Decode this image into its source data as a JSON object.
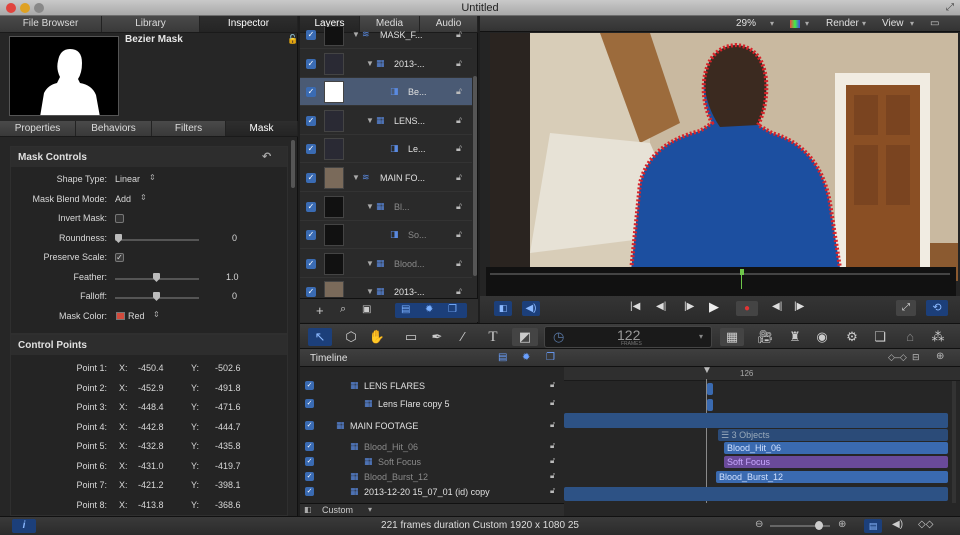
{
  "window": {
    "title": "Untitled"
  },
  "left_tabs": [
    "File Browser",
    "Library",
    "Inspector"
  ],
  "inspector": {
    "object_name": "Bezier Mask",
    "sub_tabs": [
      "Properties",
      "Behaviors",
      "Filters",
      "Mask"
    ],
    "mask_controls": {
      "title": "Mask Controls",
      "rows": [
        {
          "label": "Shape Type:",
          "value": "Linear"
        },
        {
          "label": "Mask Blend Mode:",
          "value": "Add"
        },
        {
          "label": "Invert Mask:",
          "value": ""
        },
        {
          "label": "Roundness:",
          "value": "0"
        },
        {
          "label": "Preserve Scale:",
          "value": ""
        },
        {
          "label": "Feather:",
          "value": "1.0"
        },
        {
          "label": "Falloff:",
          "value": "0"
        },
        {
          "label": "Mask Color:",
          "value": "Red"
        }
      ]
    },
    "control_points": {
      "title": "Control Points",
      "x_label": "X:",
      "y_label": "Y:",
      "points": [
        {
          "label": "Point 1:",
          "x": "-450.4",
          "y": "-502.6"
        },
        {
          "label": "Point 2:",
          "x": "-452.9",
          "y": "-491.8"
        },
        {
          "label": "Point 3:",
          "x": "-448.4",
          "y": "-471.6"
        },
        {
          "label": "Point 4:",
          "x": "-442.8",
          "y": "-444.7"
        },
        {
          "label": "Point 5:",
          "x": "-432.8",
          "y": "-435.8"
        },
        {
          "label": "Point 6:",
          "x": "-431.0",
          "y": "-419.7"
        },
        {
          "label": "Point 7:",
          "x": "-421.2",
          "y": "-398.1"
        },
        {
          "label": "Point 8:",
          "x": "-413.8",
          "y": "-368.6"
        }
      ]
    }
  },
  "center_tabs": [
    "Layers",
    "Media",
    "Audio"
  ],
  "layers": [
    {
      "name": "MASK_F...",
      "indent": 0
    },
    {
      "name": "2013-...",
      "indent": 1
    },
    {
      "name": "Be...",
      "indent": 2
    },
    {
      "name": "LENS...",
      "indent": 1
    },
    {
      "name": "Le...",
      "indent": 2
    },
    {
      "name": "MAIN FO...",
      "indent": 0
    },
    {
      "name": "Bl...",
      "indent": 1
    },
    {
      "name": "So...",
      "indent": 2
    },
    {
      "name": "Blood...",
      "indent": 1
    },
    {
      "name": "2013-...",
      "indent": 1
    }
  ],
  "viewer": {
    "zoom": "29%",
    "render_label": "Render",
    "view_label": "View"
  },
  "toolbar": {
    "frame_number": "122",
    "frame_unit": "FRAMES"
  },
  "timeline": {
    "title": "Timeline",
    "ruler_mark": "126",
    "tracks": [
      {
        "name": "LENS FLARES"
      },
      {
        "name": "Lens Flare copy 5"
      },
      {
        "name": "MAIN FOOTAGE"
      },
      {
        "name": "Blood_Hit_06"
      },
      {
        "name": "Soft Focus"
      },
      {
        "name": "Blood_Burst_12"
      },
      {
        "name": "2013-12-20 15_07_01 (id) copy"
      }
    ],
    "group_bar_label": "3 Objects",
    "clips": {
      "blood_hit": "Blood_Hit_06",
      "soft_focus": "Soft Focus",
      "blood_burst": "Blood_Burst_12"
    },
    "footer_select": "Custom"
  },
  "status": {
    "text": "221 frames duration Custom 1920 x 1080 25"
  }
}
